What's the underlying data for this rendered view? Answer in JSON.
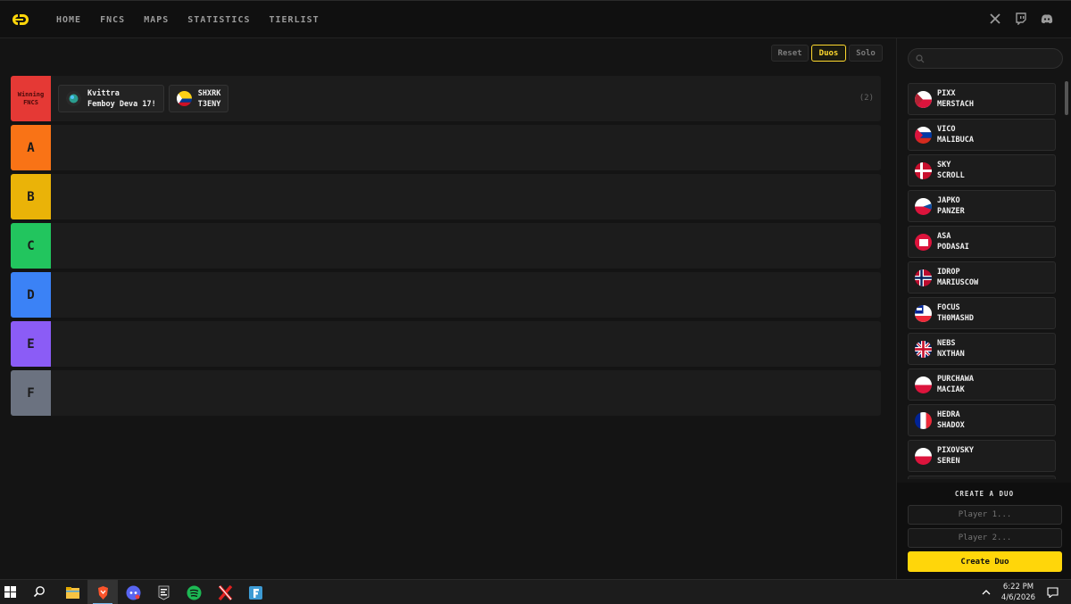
{
  "nav": {
    "links": [
      "HOME",
      "FNCS",
      "MAPS",
      "STATISTICS",
      "TIERLIST"
    ],
    "icons": [
      "x-icon",
      "twitch-icon",
      "discord-icon"
    ]
  },
  "modes": {
    "reset": "Reset",
    "duos": "Duos",
    "solo": "Solo",
    "active": "Duos"
  },
  "tiers": [
    {
      "label": "Winning FNCS",
      "color": "#e53935",
      "count": "(2)",
      "cards": [
        {
          "names": [
            "Kvittra",
            "Femboy Deva 17!"
          ],
          "flag": "globe"
        },
        {
          "names": [
            "SHXRK",
            "T3ENY"
          ],
          "flag": "colombia-mix"
        }
      ]
    },
    {
      "label": "A",
      "color": "#f97316",
      "count": "",
      "cards": []
    },
    {
      "label": "B",
      "color": "#eab308",
      "count": "",
      "cards": []
    },
    {
      "label": "C",
      "color": "#22c55e",
      "count": "",
      "cards": []
    },
    {
      "label": "D",
      "color": "#3b82f6",
      "count": "",
      "cards": []
    },
    {
      "label": "E",
      "color": "#8b5cf6",
      "count": "",
      "cards": []
    },
    {
      "label": "F",
      "color": "#6b7280",
      "count": "",
      "cards": []
    }
  ],
  "sidebar": {
    "search_placeholder": "",
    "players": [
      {
        "names": [
          "PIXX",
          "MERSTACH"
        ],
        "flag": "poland-mix"
      },
      {
        "names": [
          "VICO",
          "MALIBUCA"
        ],
        "flag": "slovenia"
      },
      {
        "names": [
          "SKY",
          "SCROLL"
        ],
        "flag": "denmark"
      },
      {
        "names": [
          "JAPKO",
          "PANZER"
        ],
        "flag": "slovakia-mix"
      },
      {
        "names": [
          "ASA",
          "PODASAI"
        ],
        "flag": "poland-split"
      },
      {
        "names": [
          "IDROP",
          "MARIUSCOW"
        ],
        "flag": "norway"
      },
      {
        "names": [
          "FOCUS",
          "TH0MASHD"
        ],
        "flag": "france-mix"
      },
      {
        "names": [
          "NEBS",
          "NXTHAN"
        ],
        "flag": "uk"
      },
      {
        "names": [
          "PURCHAWA",
          "MACIAK"
        ],
        "flag": "poland"
      },
      {
        "names": [
          "HEDRA",
          "SHADOX"
        ],
        "flag": "france"
      },
      {
        "names": [
          "PIXOVSKY",
          "SEREN"
        ],
        "flag": "poland"
      }
    ]
  },
  "create": {
    "title": "CREATE A DUO",
    "player1_placeholder": "Player 1...",
    "player2_placeholder": "Player 2...",
    "button": "Create Duo"
  },
  "taskbar": {
    "time": "6:22 PM",
    "date": "4/6/2026",
    "apps": [
      "file-explorer-icon",
      "brave-browser-icon",
      "discord-app-icon",
      "epic-games-icon",
      "spotify-icon",
      "xbox-x-icon",
      "fortnite-icon"
    ]
  }
}
